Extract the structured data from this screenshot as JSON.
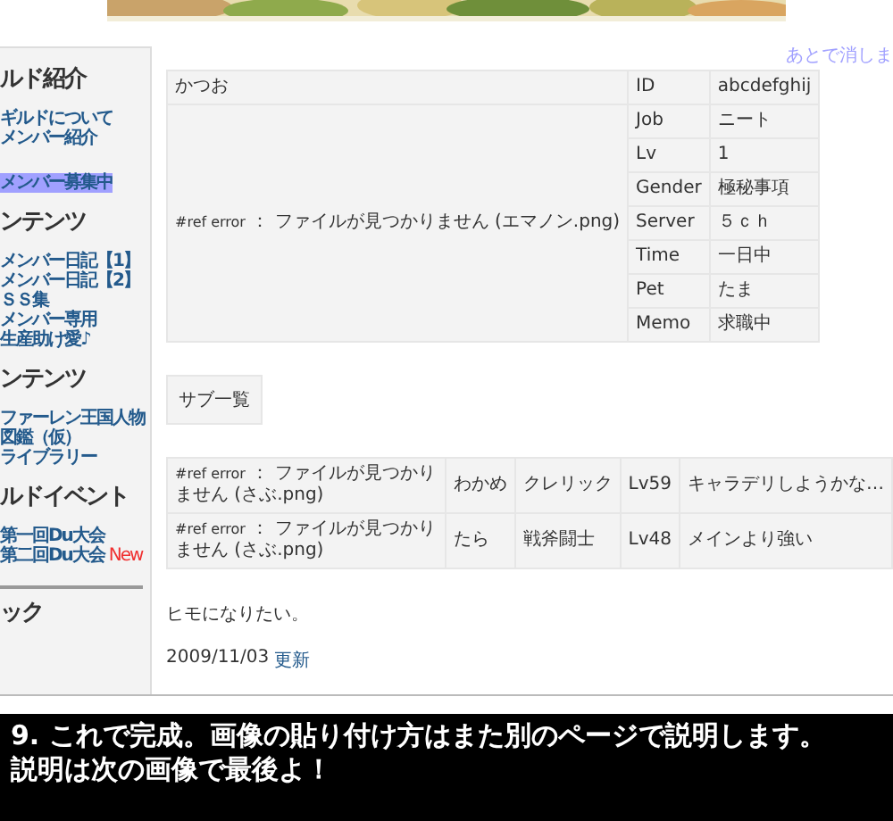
{
  "banner": {
    "kind": "picture"
  },
  "note_link": "あとで消しま",
  "sidebar": {
    "sections": [
      {
        "heading": "ルド紹介",
        "items": [
          {
            "label": "ギルドについて",
            "selected": false
          },
          {
            "label": "メンバー紹介",
            "selected": false
          },
          {
            "label": "メンバー募集中",
            "selected": true
          }
        ]
      },
      {
        "heading": "ンテンツ",
        "items": [
          {
            "label": "メンバー日記【1】",
            "selected": false
          },
          {
            "label": "メンバー日記【2】",
            "selected": false
          },
          {
            "label": "ＳＳ集",
            "selected": false
          },
          {
            "label": "メンバー専用",
            "selected": false
          },
          {
            "label": "生産助け愛♪",
            "selected": false
          }
        ]
      },
      {
        "heading": "ンテンツ",
        "items": [
          {
            "label": "ファーレン王国人物図鑑（仮）",
            "selected": false
          },
          {
            "label": "ライブラリー",
            "selected": false
          }
        ]
      },
      {
        "heading": "ルドイベント",
        "items": [
          {
            "label": "第一回Du大会",
            "selected": false
          },
          {
            "label": "第二回Du大会",
            "selected": false,
            "badge": "New"
          }
        ]
      },
      {
        "heading": "ック"
      }
    ]
  },
  "profile": {
    "name": "かつお",
    "error": {
      "code": "#ref error",
      "message": "： ファイルが見つかりません (エマノン.png)"
    },
    "fields": [
      {
        "label": "ID",
        "value": "abcdefghij"
      },
      {
        "label": "Job",
        "value": "ニート"
      },
      {
        "label": "Lv",
        "value": "1"
      },
      {
        "label": "Gender",
        "value": "極秘事項"
      },
      {
        "label": "Server",
        "value": "５ｃｈ"
      },
      {
        "label": "Time",
        "value": "一日中"
      },
      {
        "label": "Pet",
        "value": "たま"
      },
      {
        "label": "Memo",
        "value": "求職中"
      }
    ]
  },
  "sub_button": "サブ一覧",
  "sub_table": {
    "rows": [
      {
        "error": {
          "code": "#ref error",
          "message": "： ファイルが見つかりません (さぶ.png)"
        },
        "name": "わかめ",
        "job": "クレリック",
        "level": "Lv59",
        "comment": "キャラデリしようかな…"
      },
      {
        "error": {
          "code": "#ref error",
          "message": "： ファイルが見つかりません (さぶ.png)"
        },
        "name": "たら",
        "job": "戦斧闘士",
        "level": "Lv48",
        "comment": "メインより強い"
      }
    ]
  },
  "comment": "ヒモになりたい。",
  "updated": {
    "date": "2009/11/03",
    "link": "更新"
  },
  "caption": [
    "9. これで完成。画像の貼り付け方はまた別のページで説明します。",
    "説明は次の画像で最後よ！"
  ]
}
